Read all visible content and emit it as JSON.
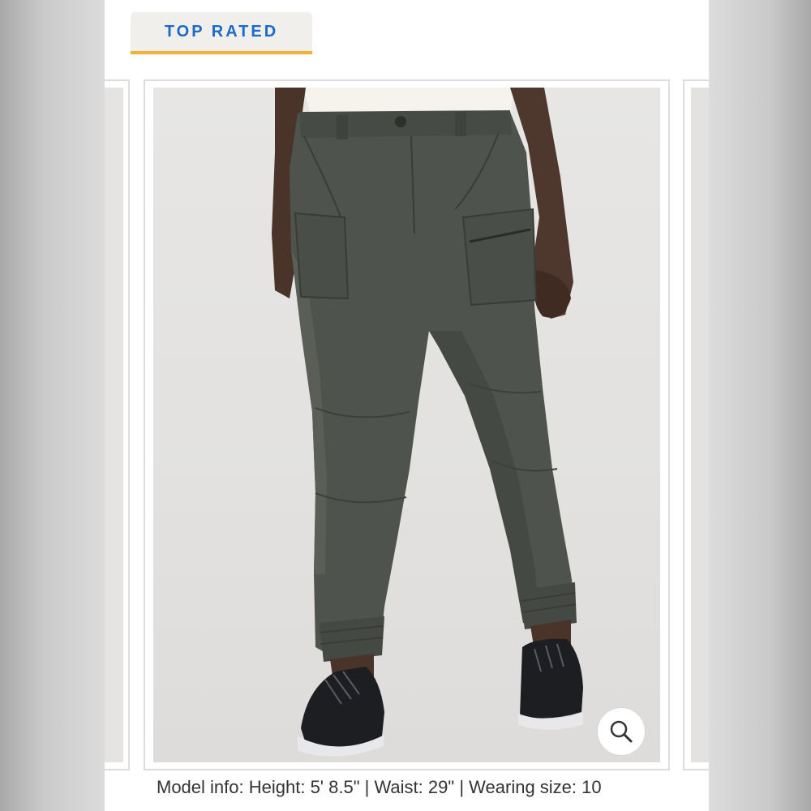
{
  "badge": {
    "label": "TOP RATED"
  },
  "product_image": {
    "alt": "Women's dark olive cargo jogger pants worn with black running shoes"
  },
  "zoom": {
    "icon": "magnifier-icon"
  },
  "model_info": {
    "label": "Model info:",
    "height": "Height: 5' 8.5\"",
    "waist": "Waist: 29\"",
    "size": "Wearing size: 10",
    "separator": "|"
  },
  "colors": {
    "accent": "#1b6ac9",
    "badge_underline": "#f2b13a",
    "pants": "#4f534d"
  }
}
